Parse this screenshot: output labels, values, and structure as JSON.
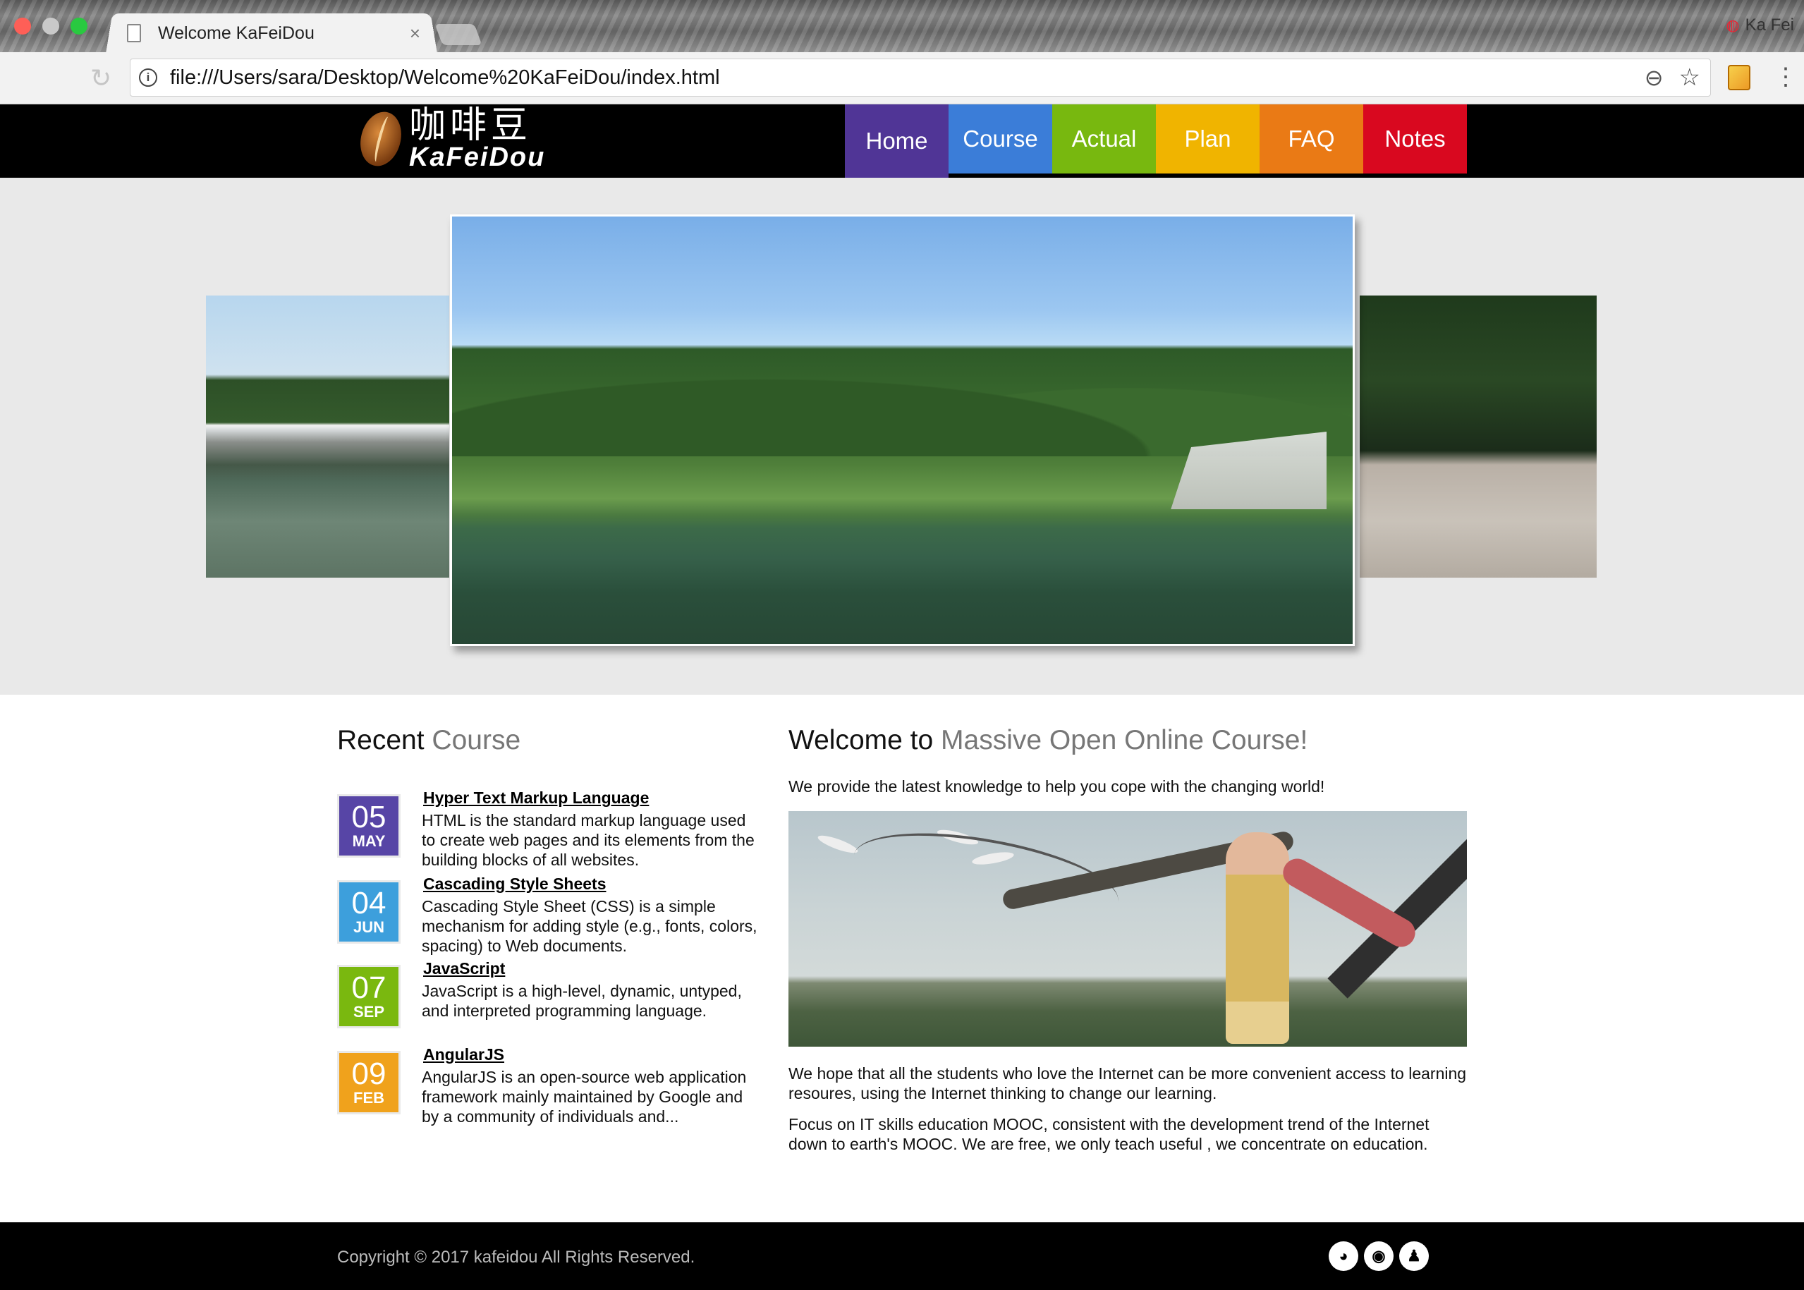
{
  "browser": {
    "tab_title": "Welcome KaFeiDou",
    "tab_close": "×",
    "url": "file:///Users/sara/Desktop/Welcome%20KaFeiDou/index.html",
    "profile_name": "Ka Fei"
  },
  "site": {
    "logo_cn": "咖啡豆",
    "logo_en": "KaFeiDou",
    "nav": [
      {
        "label": "Home",
        "color": "#503596"
      },
      {
        "label": "Course",
        "color": "#3b7dd8"
      },
      {
        "label": "Actual",
        "color": "#78b80f"
      },
      {
        "label": "Plan",
        "color": "#f0b400"
      },
      {
        "label": "FAQ",
        "color": "#ea7a15"
      },
      {
        "label": "Notes",
        "color": "#d9081f"
      }
    ]
  },
  "recent": {
    "title_main": "Recent",
    "title_accent": "Course",
    "courses": [
      {
        "day": "05",
        "month": "MAY",
        "color": "#5745a6",
        "title": "Hyper Text Markup Language",
        "desc": "HTML is the standard markup language used to create web pages and its elements from the building blocks of all websites."
      },
      {
        "day": "04",
        "month": "JUN",
        "color": "#3d9fdc",
        "title": "Cascading Style Sheets",
        "desc": "Cascading Style Sheet (CSS) is a simple mechanism for adding style (e.g., fonts, colors, spacing) to Web documents."
      },
      {
        "day": "07",
        "month": "SEP",
        "color": "#7ab80f",
        "title": "JavaScript",
        "desc": "JavaScript is a high-level, dynamic, untyped, and interpreted programming language."
      },
      {
        "day": "09",
        "month": "FEB",
        "color": "#f0a21c",
        "title": "AngularJS",
        "desc": "AngularJS is an open-source web application framework mainly maintained by Google and by a community of individuals and..."
      }
    ]
  },
  "welcome": {
    "title_main": "Welcome to",
    "title_accent": "Massive Open Online Course!",
    "intro": "We provide the latest knowledge to help you cope with the changing world!",
    "para1": "We hope that all the students who love the Internet can be more convenient access to learning resoures, using the Internet thinking to change our learning.",
    "para2": "Focus on IT skills education MOOC, consistent with the development trend of the Internet down to earth's MOOC. We are free, we only teach useful , we concentrate on education."
  },
  "footer": {
    "copyright": "Copyright © 2017 kafeidou All Rights Reserved.",
    "social_icons": [
      "wechat-icon",
      "weibo-icon",
      "qq-icon"
    ]
  }
}
